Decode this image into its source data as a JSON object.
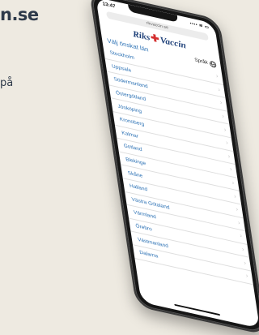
{
  "background": {
    "title": "n.se",
    "snippet": "på"
  },
  "phone": {
    "status": {
      "time": "13:47",
      "signal": "•••• ≋ ▭"
    },
    "url": "rikvaccin.se",
    "logo": {
      "left": "Riks",
      "plus": "✚",
      "right": "Vaccin"
    },
    "heading": "Välj önskat län",
    "language_label": "Språk",
    "counties": [
      "Stockholm",
      "Uppsala",
      "Södermanland",
      "Östergötland",
      "Jönköping",
      "Kronoberg",
      "Kalmar",
      "Gotland",
      "Blekinge",
      "Skåne",
      "Halland",
      "Västra Götaland",
      "Värmland",
      "Örebro",
      "Västmanland",
      "Dalarna"
    ]
  },
  "colors": {
    "accent": "#2d72b5",
    "logo_blue": "#1d3f78",
    "logo_red": "#d42f2f",
    "background": "#eeeae1"
  }
}
